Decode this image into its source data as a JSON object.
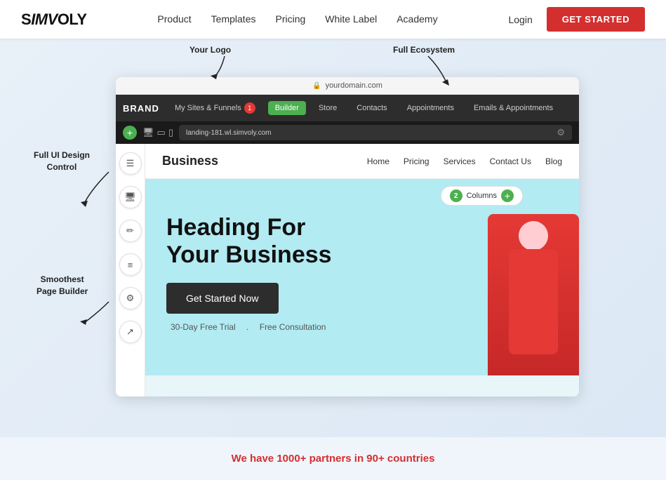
{
  "nav": {
    "logo": "SIMVOLY",
    "links": [
      "Product",
      "Templates",
      "Pricing",
      "White Label",
      "Academy"
    ],
    "login": "Login",
    "get_started": "GET STARTED"
  },
  "annotations": {
    "your_logo": "Your Logo",
    "full_ecosystem": "Full Ecosystem",
    "full_ui": "Full UI Design\nControl",
    "smoothest": "Smoothest\nPage Builder"
  },
  "browser": {
    "address": "yourdomain.com"
  },
  "app_nav": {
    "brand": "BRAND",
    "items": [
      "My Sites & Funnels",
      "Builder",
      "Store",
      "Contacts",
      "Appointments",
      "Emails & Appointments"
    ],
    "active": "Builder",
    "notif_count": "1"
  },
  "editor_toolbar": {
    "url": "landing-181.wl.simvoly.com",
    "add_label": "+"
  },
  "website": {
    "brand": "Business",
    "nav_links": [
      "Home",
      "Pricing",
      "Services",
      "Contact Us",
      "Blog"
    ],
    "columns_badge": "2",
    "hero_heading_line1": "Heading For",
    "hero_heading_line2": "Your Business",
    "cta_button": "Get Started Now",
    "sub_text1": "30-Day Free Trial",
    "sub_dot": ".",
    "sub_text2": "Free Consultation"
  },
  "sidebar_icons": [
    "☰",
    "🖥",
    "✏",
    "≡",
    "⚙",
    "↗"
  ],
  "bottom": {
    "text": "We have 1000+ partners in 90+ countries"
  }
}
